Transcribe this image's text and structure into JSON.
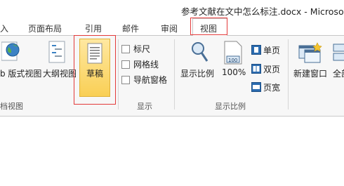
{
  "window": {
    "title": "参考文献在文中怎么标注.docx - Microso"
  },
  "tabs": [
    {
      "label": "入"
    },
    {
      "label": "页面布局"
    },
    {
      "label": "引用"
    },
    {
      "label": "邮件"
    },
    {
      "label": "审阅"
    },
    {
      "label": "视图",
      "active": true
    }
  ],
  "ribbon": {
    "view_group": {
      "label": "档视图",
      "items": [
        {
          "label": "b 版式视图",
          "icon": "web-layout-icon"
        },
        {
          "label": "大纲视图",
          "icon": "outline-view-icon"
        },
        {
          "label": "草稿",
          "icon": "draft-view-icon",
          "active": true
        }
      ]
    },
    "show_group": {
      "label": "显示",
      "checkboxes": [
        {
          "label": "标尺",
          "checked": false
        },
        {
          "label": "网格线",
          "checked": false
        },
        {
          "label": "导航窗格",
          "checked": false
        }
      ]
    },
    "zoom_group": {
      "label": "显示比例",
      "zoom_label": "显示比例",
      "percent_label": "100%",
      "percent_icon_text": "100",
      "page_buttons": [
        {
          "label": "单页",
          "icon": "one-page-icon"
        },
        {
          "label": "双页",
          "icon": "two-pages-icon"
        },
        {
          "label": "页宽",
          "icon": "page-width-icon"
        }
      ]
    },
    "window_group": {
      "new_window_label": "新建窗口",
      "arrange_all_label": "全部"
    }
  },
  "colors": {
    "highlight_red": "#e33a3a",
    "draft_active": "#f9cf55",
    "icon_blue": "#2b6cb0"
  }
}
